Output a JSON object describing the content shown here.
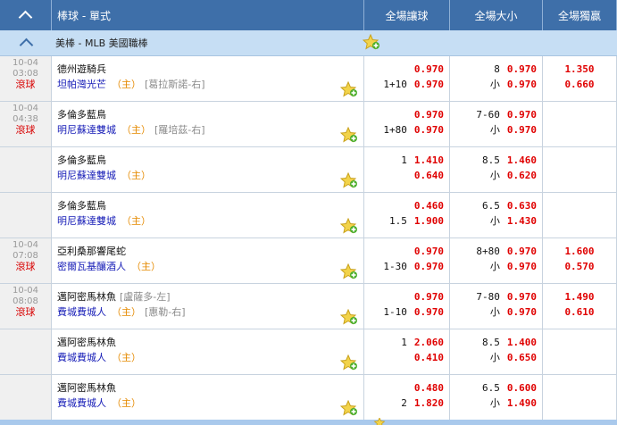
{
  "header": {
    "title": "棒球 - 單式",
    "col_handicap": "全場讓球",
    "col_overunder": "全場大小",
    "col_moneyline": "全場獨贏"
  },
  "league": {
    "name": "美棒 - MLB 美國職棒"
  },
  "rows": [
    {
      "date": "10-04",
      "time": "03:08",
      "status": "滾球",
      "team1": "德州遊騎兵",
      "team1_pitcher": "",
      "team2": "坦帕灣光芒",
      "team2_home": "（主）",
      "team2_pitcher": "[葛拉斯諾-右]",
      "hdp": [
        [
          "",
          "0.970"
        ],
        [
          "1+10",
          "0.970"
        ]
      ],
      "ou": [
        [
          "8",
          "0.970"
        ],
        [
          "小",
          "0.970"
        ]
      ],
      "ml": [
        "1.350",
        "0.660"
      ]
    },
    {
      "date": "10-04",
      "time": "04:38",
      "status": "滾球",
      "team1": "多倫多藍鳥",
      "team1_pitcher": "",
      "team2": "明尼蘇達雙城",
      "team2_home": "（主）",
      "team2_pitcher": "[羅培茲-右]",
      "hdp": [
        [
          "",
          "0.970"
        ],
        [
          "1+80",
          "0.970"
        ]
      ],
      "ou": [
        [
          "7-60",
          "0.970"
        ],
        [
          "小",
          "0.970"
        ]
      ],
      "ml": [
        "",
        ""
      ]
    },
    {
      "date": "",
      "time": "",
      "status": "",
      "team1": "多倫多藍鳥",
      "team1_pitcher": "",
      "team2": "明尼蘇達雙城",
      "team2_home": "（主）",
      "team2_pitcher": "",
      "hdp": [
        [
          "1",
          "1.410"
        ],
        [
          "",
          "0.640"
        ]
      ],
      "ou": [
        [
          "8.5",
          "1.460"
        ],
        [
          "小",
          "0.620"
        ]
      ],
      "ml": [
        "",
        ""
      ]
    },
    {
      "date": "",
      "time": "",
      "status": "",
      "team1": "多倫多藍鳥",
      "team1_pitcher": "",
      "team2": "明尼蘇達雙城",
      "team2_home": "（主）",
      "team2_pitcher": "",
      "hdp": [
        [
          "",
          "0.460"
        ],
        [
          "1.5",
          "1.900"
        ]
      ],
      "ou": [
        [
          "6.5",
          "0.630"
        ],
        [
          "小",
          "1.430"
        ]
      ],
      "ml": [
        "",
        ""
      ]
    },
    {
      "date": "10-04",
      "time": "07:08",
      "status": "滾球",
      "team1": "亞利桑那響尾蛇",
      "team1_pitcher": "",
      "team2": "密爾瓦基釀酒人",
      "team2_home": "（主）",
      "team2_pitcher": "",
      "hdp": [
        [
          "",
          "0.970"
        ],
        [
          "1-30",
          "0.970"
        ]
      ],
      "ou": [
        [
          "8+80",
          "0.970"
        ],
        [
          "小",
          "0.970"
        ]
      ],
      "ml": [
        "1.600",
        "0.570"
      ]
    },
    {
      "date": "10-04",
      "time": "08:08",
      "status": "滾球",
      "team1": "邁阿密馬林魚",
      "team1_pitcher": "[盧薩多-左]",
      "team2": "費城費城人",
      "team2_home": "（主）",
      "team2_pitcher": "[惠勒-右]",
      "hdp": [
        [
          "",
          "0.970"
        ],
        [
          "1-10",
          "0.970"
        ]
      ],
      "ou": [
        [
          "7-80",
          "0.970"
        ],
        [
          "小",
          "0.970"
        ]
      ],
      "ml": [
        "1.490",
        "0.610"
      ]
    },
    {
      "date": "",
      "time": "",
      "status": "",
      "team1": "邁阿密馬林魚",
      "team1_pitcher": "",
      "team2": "費城費城人",
      "team2_home": "（主）",
      "team2_pitcher": "",
      "hdp": [
        [
          "1",
          "2.060"
        ],
        [
          "",
          "0.410"
        ]
      ],
      "ou": [
        [
          "8.5",
          "1.400"
        ],
        [
          "小",
          "0.650"
        ]
      ],
      "ml": [
        "",
        ""
      ]
    },
    {
      "date": "",
      "time": "",
      "status": "",
      "team1": "邁阿密馬林魚",
      "team1_pitcher": "",
      "team2": "費城費城人",
      "team2_home": "（主）",
      "team2_pitcher": "",
      "hdp": [
        [
          "",
          "0.480"
        ],
        [
          "2",
          "1.820"
        ]
      ],
      "ou": [
        [
          "6.5",
          "0.600"
        ],
        [
          "小",
          "1.490"
        ]
      ],
      "ml": [
        "",
        ""
      ]
    }
  ],
  "colors": {
    "header_bg": "#3e6fa9",
    "league_bg": "#c6def4",
    "odds_red": "#e00000",
    "home_orange": "#e58a00",
    "team_blue": "#1a20b8"
  },
  "icons": {
    "collapse": "chevron-up-icon",
    "favorite": "star-add-icon"
  }
}
